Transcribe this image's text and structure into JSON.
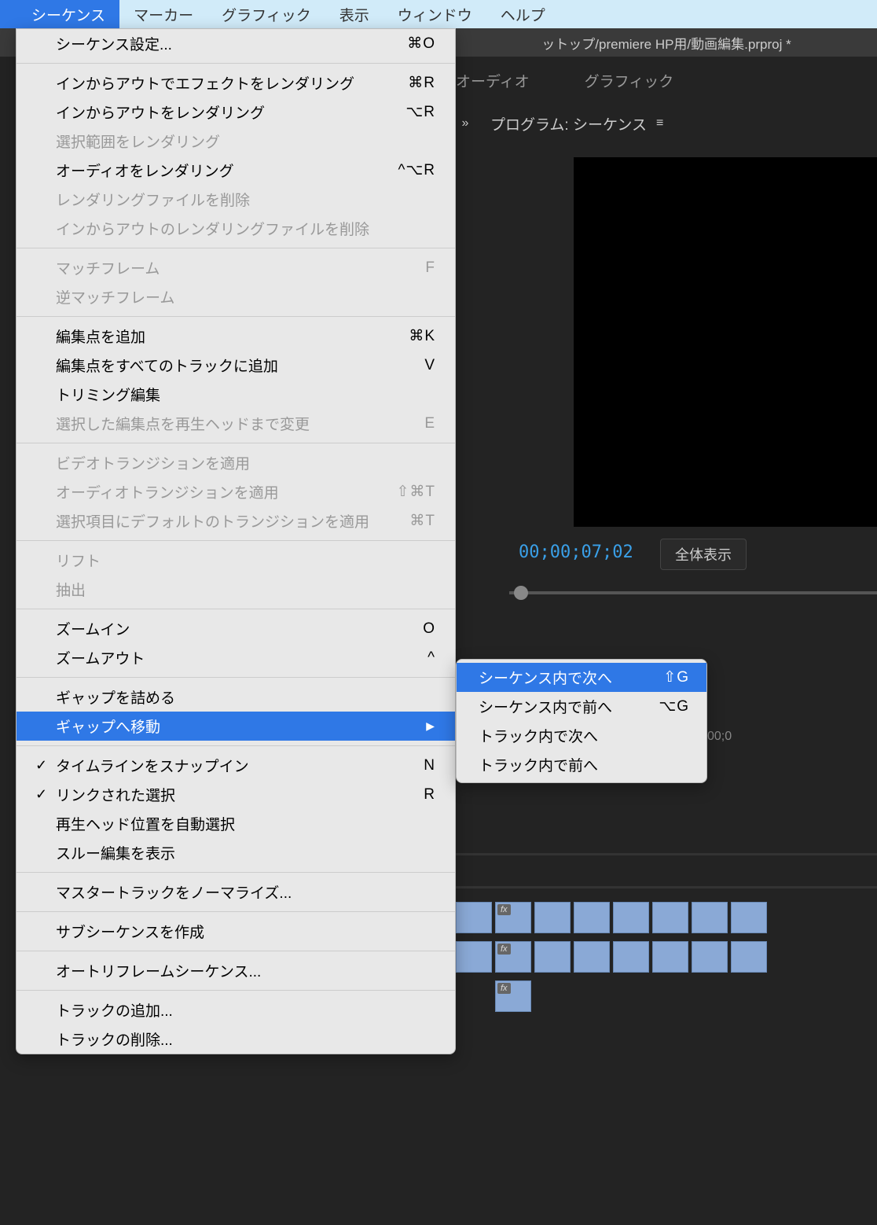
{
  "menubar": {
    "items": [
      "シーケンス",
      "マーカー",
      "グラフィック",
      "表示",
      "ウィンドウ",
      "ヘルプ"
    ]
  },
  "titlebar": {
    "path": "ットップ/premiere HP用/動画編集.prproj *"
  },
  "workspace": {
    "tabs": [
      "オーディオ",
      "グラフィック"
    ]
  },
  "program_panel": {
    "label": "プログラム: シーケンス",
    "timecode": "00;00;07;02",
    "fit_label": "全体表示"
  },
  "timeline": {
    "timecode": "00;0"
  },
  "menu": {
    "groups": [
      [
        {
          "label": "シーケンス設定...",
          "shortcut": "⌘O",
          "enabled": true
        }
      ],
      [
        {
          "label": "インからアウトでエフェクトをレンダリング",
          "shortcut": "⌘R",
          "enabled": true
        },
        {
          "label": "インからアウトをレンダリング",
          "shortcut": "⌥R",
          "enabled": true
        },
        {
          "label": "選択範囲をレンダリング",
          "shortcut": "",
          "enabled": false
        },
        {
          "label": "オーディオをレンダリング",
          "shortcut": "^⌥R",
          "enabled": true
        },
        {
          "label": "レンダリングファイルを削除",
          "shortcut": "",
          "enabled": false
        },
        {
          "label": "インからアウトのレンダリングファイルを削除",
          "shortcut": "",
          "enabled": false
        }
      ],
      [
        {
          "label": "マッチフレーム",
          "shortcut": "F",
          "enabled": false
        },
        {
          "label": "逆マッチフレーム",
          "shortcut": "",
          "enabled": false
        }
      ],
      [
        {
          "label": "編集点を追加",
          "shortcut": "⌘K",
          "enabled": true
        },
        {
          "label": "編集点をすべてのトラックに追加",
          "shortcut": "V",
          "enabled": true
        },
        {
          "label": "トリミング編集",
          "shortcut": "",
          "enabled": true
        },
        {
          "label": "選択した編集点を再生ヘッドまで変更",
          "shortcut": "E",
          "enabled": false
        }
      ],
      [
        {
          "label": "ビデオトランジションを適用",
          "shortcut": "",
          "enabled": false
        },
        {
          "label": "オーディオトランジションを適用",
          "shortcut": "⇧⌘T",
          "enabled": false
        },
        {
          "label": "選択項目にデフォルトのトランジションを適用",
          "shortcut": "⌘T",
          "enabled": false
        }
      ],
      [
        {
          "label": "リフト",
          "shortcut": "",
          "enabled": false
        },
        {
          "label": "抽出",
          "shortcut": "",
          "enabled": false
        }
      ],
      [
        {
          "label": "ズームイン",
          "shortcut": "O",
          "enabled": true
        },
        {
          "label": "ズームアウト",
          "shortcut": "^",
          "enabled": true
        }
      ],
      [
        {
          "label": "ギャップを詰める",
          "shortcut": "",
          "enabled": true
        },
        {
          "label": "ギャップへ移動",
          "shortcut": "",
          "enabled": true,
          "submenu": true,
          "highlighted": true
        }
      ],
      [
        {
          "label": "タイムラインをスナップイン",
          "shortcut": "N",
          "enabled": true,
          "checked": true
        },
        {
          "label": "リンクされた選択",
          "shortcut": "R",
          "enabled": true,
          "checked": true
        },
        {
          "label": "再生ヘッド位置を自動選択",
          "shortcut": "",
          "enabled": true
        },
        {
          "label": "スルー編集を表示",
          "shortcut": "",
          "enabled": true
        }
      ],
      [
        {
          "label": "マスタートラックをノーマライズ...",
          "shortcut": "",
          "enabled": true
        }
      ],
      [
        {
          "label": "サブシーケンスを作成",
          "shortcut": "",
          "enabled": true
        }
      ],
      [
        {
          "label": "オートリフレームシーケンス...",
          "shortcut": "",
          "enabled": true
        }
      ],
      [
        {
          "label": "トラックの追加...",
          "shortcut": "",
          "enabled": true
        },
        {
          "label": "トラックの削除...",
          "shortcut": "",
          "enabled": true
        }
      ]
    ]
  },
  "submenu": {
    "items": [
      {
        "label": "シーケンス内で次へ",
        "shortcut": "⇧G",
        "highlighted": true
      },
      {
        "label": "シーケンス内で前へ",
        "shortcut": "⌥G"
      },
      {
        "label": "トラック内で次へ",
        "shortcut": ""
      },
      {
        "label": "トラック内で前へ",
        "shortcut": ""
      }
    ]
  },
  "fx_label": "fx"
}
